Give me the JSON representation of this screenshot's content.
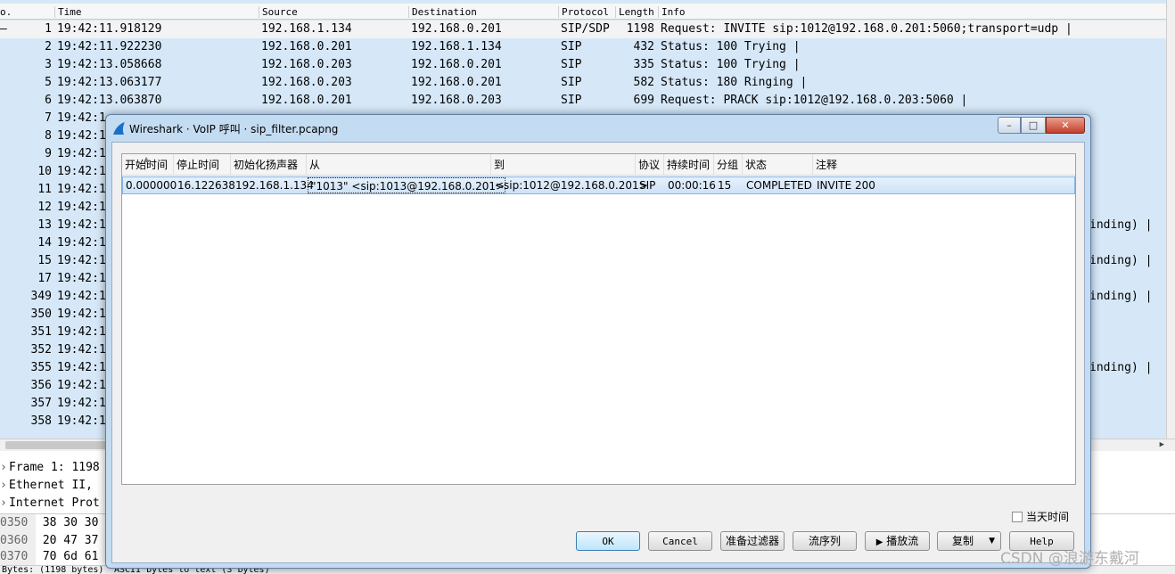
{
  "packet_list": {
    "columns": [
      "o.",
      "Time",
      "Source",
      "Destination",
      "Protocol",
      "Length",
      "Info"
    ],
    "rows": [
      {
        "marker": "–",
        "no": "1",
        "time": "19:42:11.918129",
        "src": "192.168.1.134",
        "dst": "192.168.0.201",
        "proto": "SIP/SDP",
        "len": "1198",
        "info": "Request: INVITE sip:1012@192.168.0.201:5060;transport=udp |"
      },
      {
        "marker": "",
        "no": "2",
        "time": "19:42:11.922230",
        "src": "192.168.0.201",
        "dst": "192.168.1.134",
        "proto": "SIP",
        "len": "432",
        "info": "Status: 100 Trying |"
      },
      {
        "marker": "",
        "no": "3",
        "time": "19:42:13.058668",
        "src": "192.168.0.203",
        "dst": "192.168.0.201",
        "proto": "SIP",
        "len": "335",
        "info": "Status: 100 Trying |"
      },
      {
        "marker": "",
        "no": "5",
        "time": "19:42:13.063177",
        "src": "192.168.0.203",
        "dst": "192.168.0.201",
        "proto": "SIP",
        "len": "582",
        "info": "Status: 180 Ringing |"
      },
      {
        "marker": "",
        "no": "6",
        "time": "19:42:13.063870",
        "src": "192.168.0.201",
        "dst": "192.168.0.203",
        "proto": "SIP",
        "len": "699",
        "info": "Request: PRACK sip:1012@192.168.0.203:5060 |"
      },
      {
        "marker": "",
        "no": "7",
        "time": "19:42:1",
        "src": "",
        "dst": "",
        "proto": "",
        "len": "",
        "info": ""
      },
      {
        "marker": "",
        "no": "8",
        "time": "19:42:1",
        "src": "",
        "dst": "",
        "proto": "",
        "len": "",
        "info": ""
      },
      {
        "marker": "",
        "no": "9",
        "time": "19:42:1",
        "src": "",
        "dst": "",
        "proto": "",
        "len": "",
        "info": ""
      },
      {
        "marker": "",
        "no": "10",
        "time": "19:42:1",
        "src": "",
        "dst": "",
        "proto": "",
        "len": "",
        "info": ""
      },
      {
        "marker": "",
        "no": "11",
        "time": "19:42:1",
        "src": "",
        "dst": "",
        "proto": "",
        "len": "",
        "info": ""
      },
      {
        "marker": "",
        "no": "12",
        "time": "19:42:1",
        "src": "",
        "dst": "",
        "proto": "",
        "len": "",
        "info": ""
      },
      {
        "marker": "",
        "no": "13",
        "time": "19:42:1",
        "src": "",
        "dst": "",
        "proto": "",
        "len": "",
        "info": "inding) |"
      },
      {
        "marker": "",
        "no": "14",
        "time": "19:42:1",
        "src": "",
        "dst": "",
        "proto": "",
        "len": "",
        "info": ""
      },
      {
        "marker": "",
        "no": "15",
        "time": "19:42:1",
        "src": "",
        "dst": "",
        "proto": "",
        "len": "",
        "info": "inding) |"
      },
      {
        "marker": "",
        "no": "17",
        "time": "19:42:1",
        "src": "",
        "dst": "",
        "proto": "",
        "len": "",
        "info": ""
      },
      {
        "marker": "",
        "no": "349",
        "time": "19:42:1",
        "src": "",
        "dst": "",
        "proto": "",
        "len": "",
        "info": "inding) |"
      },
      {
        "marker": "",
        "no": "350",
        "time": "19:42:1",
        "src": "",
        "dst": "",
        "proto": "",
        "len": "",
        "info": ""
      },
      {
        "marker": "",
        "no": "351",
        "time": "19:42:1",
        "src": "",
        "dst": "",
        "proto": "",
        "len": "",
        "info": ""
      },
      {
        "marker": "",
        "no": "352",
        "time": "19:42:1",
        "src": "",
        "dst": "",
        "proto": "",
        "len": "",
        "info": ""
      },
      {
        "marker": "",
        "no": "355",
        "time": "19:42:1",
        "src": "",
        "dst": "",
        "proto": "",
        "len": "",
        "info": "inding) |"
      },
      {
        "marker": "",
        "no": "356",
        "time": "19:42:1",
        "src": "",
        "dst": "",
        "proto": "",
        "len": "",
        "info": ""
      },
      {
        "marker": "",
        "no": "357",
        "time": "19:42:1",
        "src": "",
        "dst": "",
        "proto": "",
        "len": "",
        "info": ""
      },
      {
        "marker": "",
        "no": "358",
        "time": "19:42:1",
        "src": "",
        "dst": "",
        "proto": "",
        "len": "",
        "info": ""
      }
    ]
  },
  "details": {
    "items": [
      "Frame 1: 1198",
      "Ethernet II, ",
      "Internet Prot"
    ]
  },
  "bytes": {
    "rows": [
      {
        "offset": "0350",
        "hex": "38 30 30"
      },
      {
        "offset": "0360",
        "hex": "20 47 37"
      },
      {
        "offset": "0370",
        "hex": "70 6d 61"
      }
    ]
  },
  "status": {
    "left": "Bytes: (1198 bytes)",
    "right": "ASCII bytes to text (3 bytes)"
  },
  "dialog": {
    "title": "Wireshark · VoIP 呼叫 · sip_filter.pcapng",
    "window_buttons": {
      "minimize": "–",
      "maximize": "□",
      "close": "✕"
    },
    "columns": [
      "开始时间",
      "停止时间",
      "初始化扬声器",
      "从",
      "到",
      "协议",
      "持续时间",
      "分组",
      "状态",
      "注释"
    ],
    "calls": [
      {
        "start": "0.000000",
        "stop": "16.122638",
        "initiator": "192.168.1.134",
        "from": "\"1013\" <sip:1013@192.168.0.201>",
        "to": "<sip:1012@192.168.0.201>",
        "protocol": "SIP",
        "duration": "00:00:16",
        "packets": "15",
        "state": "COMPLETED",
        "comment": "INVITE 200"
      }
    ],
    "time_of_day_label": "当天时间",
    "buttons": {
      "ok": "OK",
      "cancel": "Cancel",
      "prepare_filter": "准备过滤器",
      "flow_sequence": "流序列",
      "play_streams": "播放流",
      "copy": "复制",
      "help": "Help"
    }
  },
  "watermark": "CSDN @浪游东戴河"
}
